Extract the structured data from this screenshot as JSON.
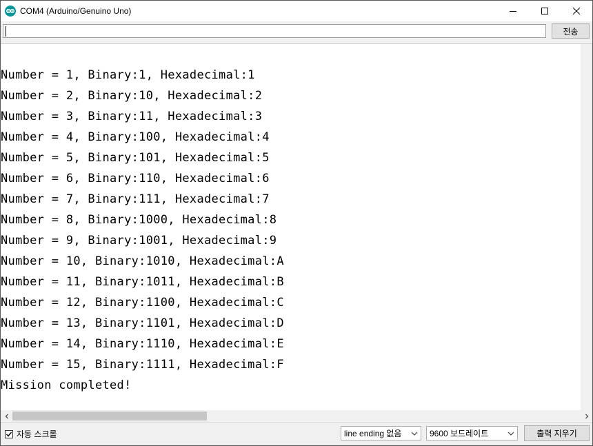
{
  "window": {
    "title": "COM4 (Arduino/Genuino Uno)",
    "icon": "arduino-logo-icon",
    "accent_color": "#00979c"
  },
  "send": {
    "input_value": "",
    "button_label": "전송"
  },
  "output": {
    "lines": [
      "Number = 1, Binary:1, Hexadecimal:1",
      "Number = 2, Binary:10, Hexadecimal:2",
      "Number = 3, Binary:11, Hexadecimal:3",
      "Number = 4, Binary:100, Hexadecimal:4",
      "Number = 5, Binary:101, Hexadecimal:5",
      "Number = 6, Binary:110, Hexadecimal:6",
      "Number = 7, Binary:111, Hexadecimal:7",
      "Number = 8, Binary:1000, Hexadecimal:8",
      "Number = 9, Binary:1001, Hexadecimal:9",
      "Number = 10, Binary:1010, Hexadecimal:A",
      "Number = 11, Binary:1011, Hexadecimal:B",
      "Number = 12, Binary:1100, Hexadecimal:C",
      "Number = 13, Binary:1101, Hexadecimal:D",
      "Number = 14, Binary:1110, Hexadecimal:E",
      "Number = 15, Binary:1111, Hexadecimal:F",
      "Mission completed!"
    ]
  },
  "bottom": {
    "autoscroll_label": "자동 스크롤",
    "autoscroll_checked": true,
    "line_ending_selected": "line ending 없음",
    "baud_selected": "9600 보드레이트",
    "clear_button_label": "출력 지우기"
  }
}
